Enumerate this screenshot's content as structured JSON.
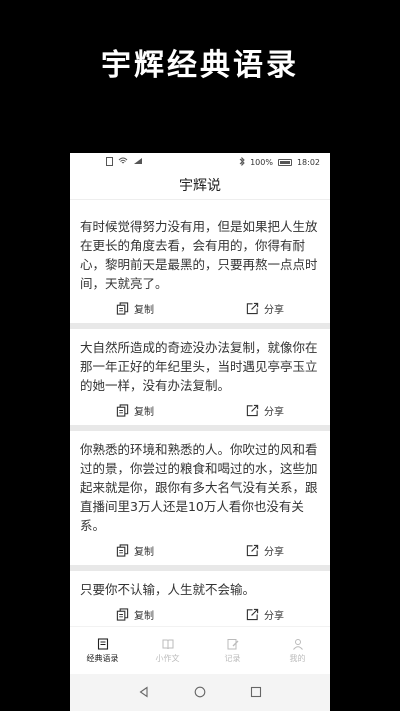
{
  "promo": {
    "title": "宇辉经典语录"
  },
  "status": {
    "battery": "100%",
    "time": "18:02"
  },
  "app": {
    "title": "宇辉说"
  },
  "quotes": [
    {
      "text": "有时候觉得努力没有用，但是如果把人生放在更长的角度去看，会有用的，你得有耐心，黎明前天是最黑的，只要再熬一点点时间，天就亮了。"
    },
    {
      "text": "大自然所造成的奇迹没办法复制，就像你在那一年正好的年纪里头，当时遇见亭亭玉立的她一样，没有办法复制。"
    },
    {
      "text": "你熟悉的环境和熟悉的人。你吹过的风和看过的景，你尝过的粮食和喝过的水，这些加起来就是你，跟你有多大名气没有关系，跟直播间里3万人还是10万人看你也没有关系。"
    },
    {
      "text": "只要你不认输，人生就不会输。"
    }
  ],
  "actions": {
    "copy": "复制",
    "share": "分享"
  },
  "tabs": [
    {
      "label": "经典语录",
      "icon": "quote-doc-icon",
      "active": true
    },
    {
      "label": "小作文",
      "icon": "book-icon",
      "active": false
    },
    {
      "label": "记录",
      "icon": "edit-icon",
      "active": false
    },
    {
      "label": "我的",
      "icon": "person-icon",
      "active": false
    }
  ]
}
